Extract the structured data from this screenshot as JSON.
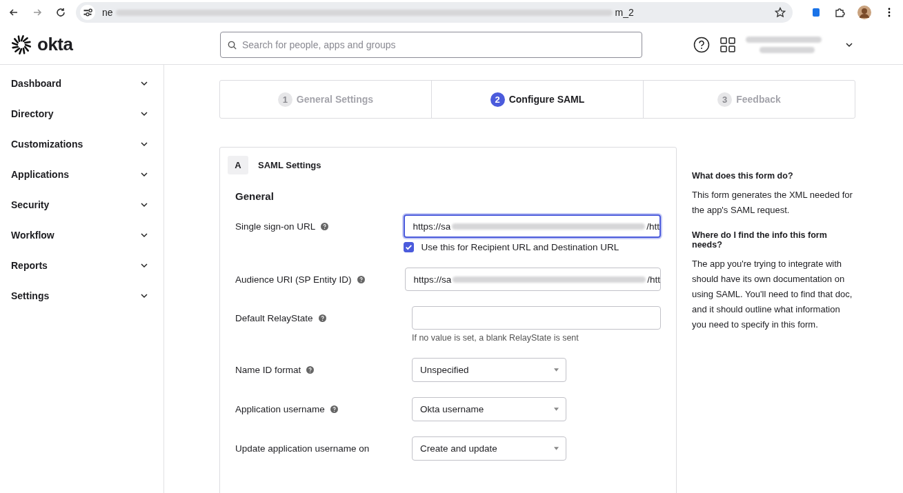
{
  "browser": {
    "url_start": "ne",
    "url_end": "m_2"
  },
  "header": {
    "logo": "okta",
    "search": {
      "placeholder": "Search for people, apps and groups"
    }
  },
  "sidebar": {
    "items": [
      {
        "label": "Dashboard",
        "expanded": false
      },
      {
        "label": "Directory",
        "expanded": false
      },
      {
        "label": "Customizations",
        "expanded": false
      },
      {
        "label": "Applications",
        "expanded": false
      },
      {
        "label": "Security",
        "expanded": false
      },
      {
        "label": "Workflow",
        "expanded": false
      },
      {
        "label": "Reports",
        "expanded": false
      },
      {
        "label": "Settings",
        "expanded": false
      }
    ]
  },
  "steps": [
    {
      "number": "1",
      "label": "General Settings",
      "selected": false
    },
    {
      "number": "2",
      "label": "Configure SAML",
      "selected": true
    },
    {
      "number": "3",
      "label": "Feedback",
      "selected": false
    }
  ],
  "section": {
    "letter": "A",
    "title": "SAML Settings",
    "subtitle": "General"
  },
  "fields": [
    {
      "kind": "text",
      "label": "Single sign-on URL",
      "help": true,
      "value_start": "https://sa",
      "value_end": "/htt",
      "focused": true,
      "checkbox": {
        "label": "Use this for Recipient URL and Destination URL",
        "checked": true
      }
    },
    {
      "kind": "text",
      "label": "Audience URI (SP Entity ID)",
      "help": true,
      "value_start": "https://sa",
      "value_end": "/htt",
      "focused": false
    },
    {
      "kind": "text",
      "label": "Default RelayState",
      "help": true,
      "focused": false,
      "hint": "If no value is set, a blank RelayState is sent"
    },
    {
      "kind": "select",
      "label": "Name ID format",
      "help": true,
      "value": "Unspecified"
    },
    {
      "kind": "select",
      "label": "Application username",
      "help": true,
      "value": "Okta username"
    },
    {
      "kind": "select",
      "label": "Update application username on",
      "help": false,
      "value": "Create and update"
    }
  ],
  "help_panel": [
    {
      "question": "What does this form do?",
      "answer": "This form generates the XML needed for the app's SAML request."
    },
    {
      "question": "Where do I find the info this form needs?",
      "answer": "The app you're trying to integrate with should have its own documentation on using SAML. You'll need to find that doc, and it should outline what information you need to specify in this form."
    }
  ]
}
